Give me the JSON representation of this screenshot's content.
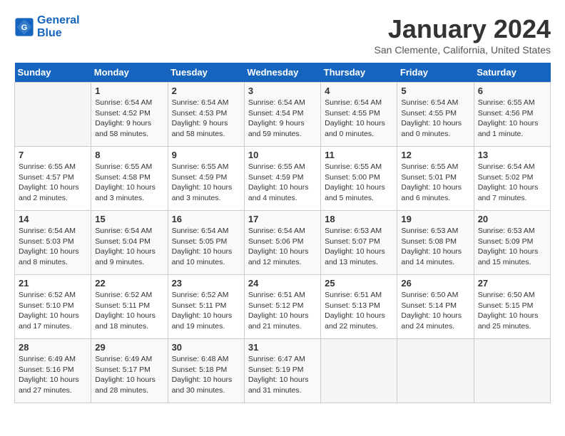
{
  "header": {
    "logo_line1": "General",
    "logo_line2": "Blue",
    "month": "January 2024",
    "location": "San Clemente, California, United States"
  },
  "weekdays": [
    "Sunday",
    "Monday",
    "Tuesday",
    "Wednesday",
    "Thursday",
    "Friday",
    "Saturday"
  ],
  "weeks": [
    [
      {
        "day": "",
        "info": ""
      },
      {
        "day": "1",
        "info": "Sunrise: 6:54 AM\nSunset: 4:52 PM\nDaylight: 9 hours\nand 58 minutes."
      },
      {
        "day": "2",
        "info": "Sunrise: 6:54 AM\nSunset: 4:53 PM\nDaylight: 9 hours\nand 58 minutes."
      },
      {
        "day": "3",
        "info": "Sunrise: 6:54 AM\nSunset: 4:54 PM\nDaylight: 9 hours\nand 59 minutes."
      },
      {
        "day": "4",
        "info": "Sunrise: 6:54 AM\nSunset: 4:55 PM\nDaylight: 10 hours\nand 0 minutes."
      },
      {
        "day": "5",
        "info": "Sunrise: 6:54 AM\nSunset: 4:55 PM\nDaylight: 10 hours\nand 0 minutes."
      },
      {
        "day": "6",
        "info": "Sunrise: 6:55 AM\nSunset: 4:56 PM\nDaylight: 10 hours\nand 1 minute."
      }
    ],
    [
      {
        "day": "7",
        "info": "Sunrise: 6:55 AM\nSunset: 4:57 PM\nDaylight: 10 hours\nand 2 minutes."
      },
      {
        "day": "8",
        "info": "Sunrise: 6:55 AM\nSunset: 4:58 PM\nDaylight: 10 hours\nand 3 minutes."
      },
      {
        "day": "9",
        "info": "Sunrise: 6:55 AM\nSunset: 4:59 PM\nDaylight: 10 hours\nand 3 minutes."
      },
      {
        "day": "10",
        "info": "Sunrise: 6:55 AM\nSunset: 4:59 PM\nDaylight: 10 hours\nand 4 minutes."
      },
      {
        "day": "11",
        "info": "Sunrise: 6:55 AM\nSunset: 5:00 PM\nDaylight: 10 hours\nand 5 minutes."
      },
      {
        "day": "12",
        "info": "Sunrise: 6:55 AM\nSunset: 5:01 PM\nDaylight: 10 hours\nand 6 minutes."
      },
      {
        "day": "13",
        "info": "Sunrise: 6:54 AM\nSunset: 5:02 PM\nDaylight: 10 hours\nand 7 minutes."
      }
    ],
    [
      {
        "day": "14",
        "info": "Sunrise: 6:54 AM\nSunset: 5:03 PM\nDaylight: 10 hours\nand 8 minutes."
      },
      {
        "day": "15",
        "info": "Sunrise: 6:54 AM\nSunset: 5:04 PM\nDaylight: 10 hours\nand 9 minutes."
      },
      {
        "day": "16",
        "info": "Sunrise: 6:54 AM\nSunset: 5:05 PM\nDaylight: 10 hours\nand 10 minutes."
      },
      {
        "day": "17",
        "info": "Sunrise: 6:54 AM\nSunset: 5:06 PM\nDaylight: 10 hours\nand 12 minutes."
      },
      {
        "day": "18",
        "info": "Sunrise: 6:53 AM\nSunset: 5:07 PM\nDaylight: 10 hours\nand 13 minutes."
      },
      {
        "day": "19",
        "info": "Sunrise: 6:53 AM\nSunset: 5:08 PM\nDaylight: 10 hours\nand 14 minutes."
      },
      {
        "day": "20",
        "info": "Sunrise: 6:53 AM\nSunset: 5:09 PM\nDaylight: 10 hours\nand 15 minutes."
      }
    ],
    [
      {
        "day": "21",
        "info": "Sunrise: 6:52 AM\nSunset: 5:10 PM\nDaylight: 10 hours\nand 17 minutes."
      },
      {
        "day": "22",
        "info": "Sunrise: 6:52 AM\nSunset: 5:11 PM\nDaylight: 10 hours\nand 18 minutes."
      },
      {
        "day": "23",
        "info": "Sunrise: 6:52 AM\nSunset: 5:11 PM\nDaylight: 10 hours\nand 19 minutes."
      },
      {
        "day": "24",
        "info": "Sunrise: 6:51 AM\nSunset: 5:12 PM\nDaylight: 10 hours\nand 21 minutes."
      },
      {
        "day": "25",
        "info": "Sunrise: 6:51 AM\nSunset: 5:13 PM\nDaylight: 10 hours\nand 22 minutes."
      },
      {
        "day": "26",
        "info": "Sunrise: 6:50 AM\nSunset: 5:14 PM\nDaylight: 10 hours\nand 24 minutes."
      },
      {
        "day": "27",
        "info": "Sunrise: 6:50 AM\nSunset: 5:15 PM\nDaylight: 10 hours\nand 25 minutes."
      }
    ],
    [
      {
        "day": "28",
        "info": "Sunrise: 6:49 AM\nSunset: 5:16 PM\nDaylight: 10 hours\nand 27 minutes."
      },
      {
        "day": "29",
        "info": "Sunrise: 6:49 AM\nSunset: 5:17 PM\nDaylight: 10 hours\nand 28 minutes."
      },
      {
        "day": "30",
        "info": "Sunrise: 6:48 AM\nSunset: 5:18 PM\nDaylight: 10 hours\nand 30 minutes."
      },
      {
        "day": "31",
        "info": "Sunrise: 6:47 AM\nSunset: 5:19 PM\nDaylight: 10 hours\nand 31 minutes."
      },
      {
        "day": "",
        "info": ""
      },
      {
        "day": "",
        "info": ""
      },
      {
        "day": "",
        "info": ""
      }
    ]
  ]
}
